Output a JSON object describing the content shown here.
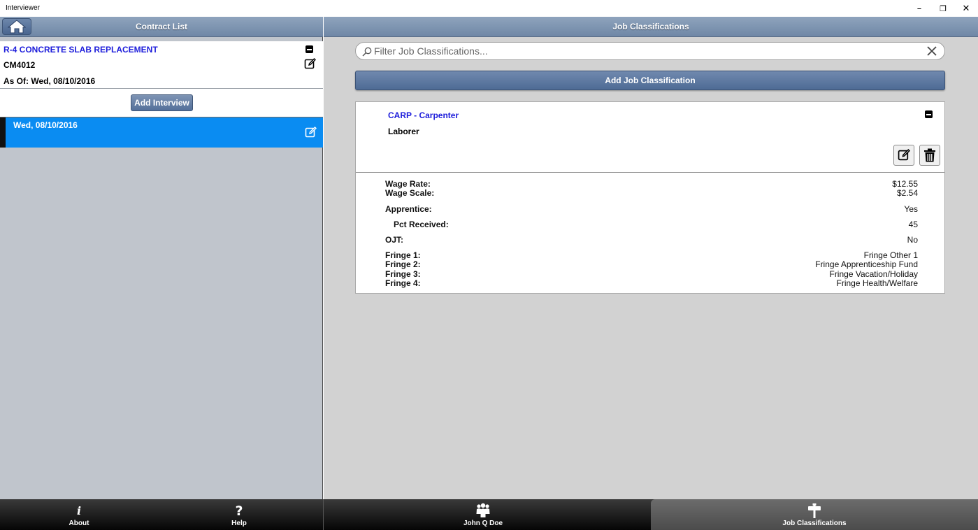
{
  "window": {
    "title": "Interviewer",
    "minimize_glyph": "–",
    "maximize_glyph": "❐",
    "close_glyph": "✕"
  },
  "left_panel": {
    "header_title": "Contract List",
    "home_icon": "home-icon",
    "contract": {
      "name": "R-4 CONCRETE SLAB REPLACEMENT",
      "number": "CM4012",
      "as_of": "As Of: Wed, 08/10/2016"
    },
    "add_interview_label": "Add Interview",
    "interviews": [
      {
        "date": "Wed, 08/10/2016",
        "selected": true
      }
    ]
  },
  "right_panel": {
    "header_title": "Job Classifications",
    "filter": {
      "placeholder": "Filter Job Classifications...",
      "value": ""
    },
    "add_job_classification_label": "Add Job Classification",
    "job_classification": {
      "title": "CARP - Carpenter",
      "subtitle": "Laborer",
      "details": {
        "wage_rate_label": "Wage Rate:",
        "wage_rate": "$12.55",
        "wage_scale_label": "Wage Scale:",
        "wage_scale": "$2.54",
        "apprentice_label": "Apprentice:",
        "apprentice": "Yes",
        "pct_received_label": "Pct Received:",
        "pct_received": "45",
        "ojt_label": "OJT:",
        "ojt": "No",
        "fringe1_label": "Fringe 1:",
        "fringe1": "Fringe Other 1",
        "fringe2_label": "Fringe 2:",
        "fringe2": "Fringe Apprenticeship Fund",
        "fringe3_label": "Fringe 3:",
        "fringe3": "Fringe Vacation/Holiday",
        "fringe4_label": "Fringe 4:",
        "fringe4": "Fringe Health/Welfare"
      }
    }
  },
  "bottom_bar": {
    "about_label": "About",
    "help_label": "Help",
    "user_label": "John Q Doe",
    "job_classifications_label": "Job Classifications",
    "active_tab": "Job Classifications"
  },
  "colors": {
    "header_blue": "#7a91b0",
    "link_blue": "#1d1ddb",
    "selected_row": "#0a8cf2",
    "button_blue": "#54709a"
  }
}
